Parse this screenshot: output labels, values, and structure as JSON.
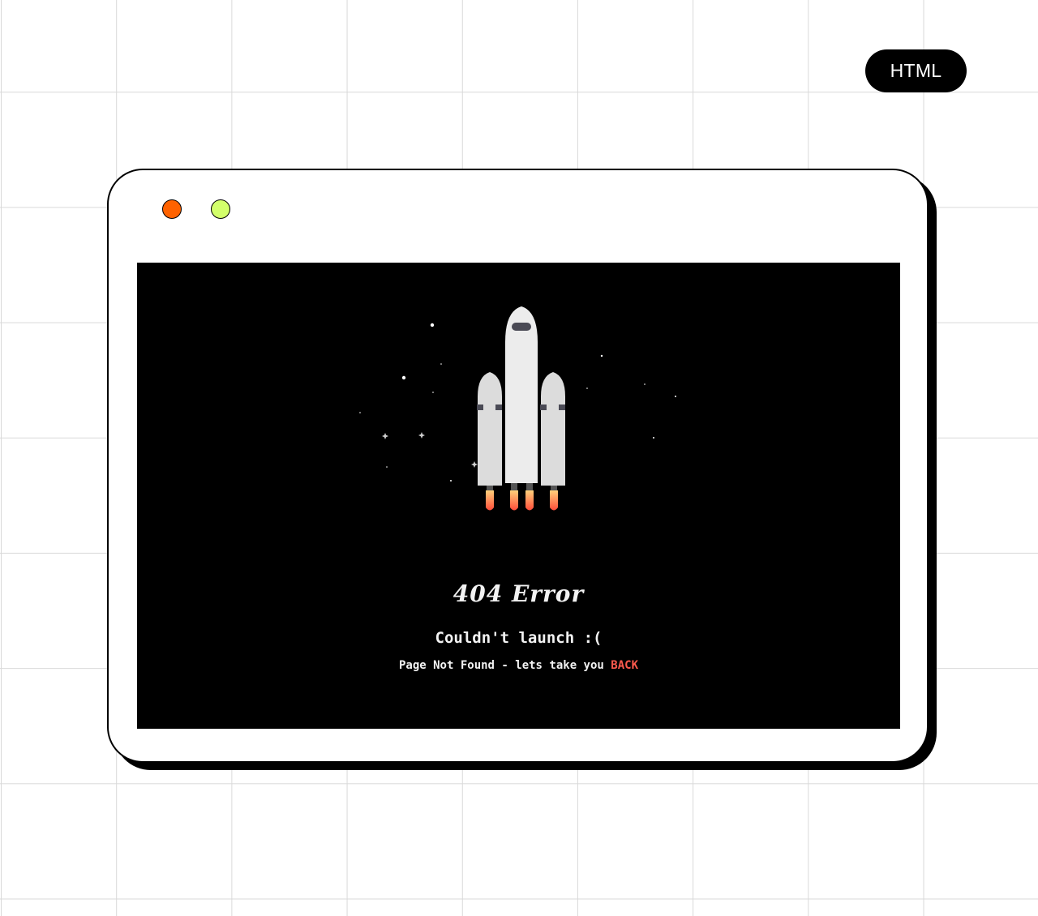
{
  "badge": {
    "label": "HTML"
  },
  "browser": {
    "dots": [
      {
        "name": "close",
        "color": "#ff6200"
      },
      {
        "name": "maximize",
        "color": "#d3ff6b"
      }
    ],
    "viewport_background": "#000000"
  },
  "error_page": {
    "title": "404 Error",
    "subtitle": "Couldn't launch :(",
    "message": "Page Not Found - lets take you",
    "back_link": "BACK",
    "link_color": "#ff5a4d"
  },
  "rocket": {
    "body_color": "#ececec",
    "booster_color": "#dcdcdc",
    "window_color": "#4a4a55",
    "flame_colors": [
      "#ff4d3a",
      "#ffd07a"
    ]
  }
}
